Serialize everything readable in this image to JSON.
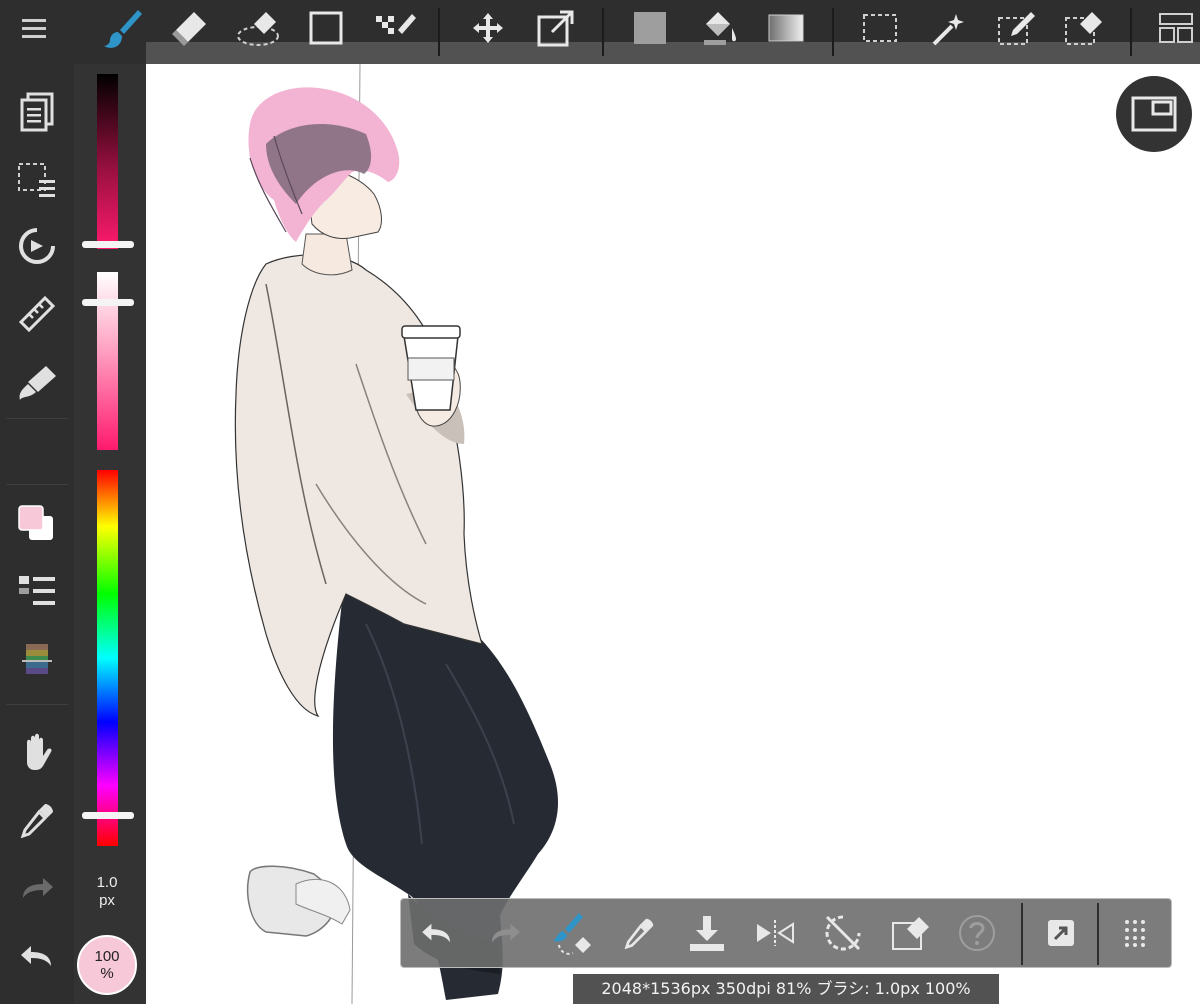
{
  "top_toolbar": {
    "tools": [
      {
        "icon": "brush-icon",
        "active": true
      },
      {
        "icon": "eraser-icon"
      },
      {
        "icon": "blur-eraser-icon"
      },
      {
        "icon": "shape-rectangle-icon"
      },
      {
        "icon": "dot-brush-icon"
      },
      {
        "icon": "move-icon"
      },
      {
        "icon": "transform-icon"
      },
      {
        "icon": "fill-color-icon"
      },
      {
        "icon": "bucket-icon"
      },
      {
        "icon": "gradient-icon"
      },
      {
        "icon": "select-rect-icon"
      },
      {
        "icon": "magic-wand-icon"
      },
      {
        "icon": "select-pen-icon"
      },
      {
        "icon": "select-eraser-icon"
      },
      {
        "icon": "layout-icon"
      }
    ],
    "accent_color": "#2f95c8",
    "fill_color": "#9e9e9e"
  },
  "left_toolbar": {
    "items": [
      "layers-icon",
      "select-menu-icon",
      "rotate-icon",
      "ruler-icon",
      "filter-icon",
      "color-swatch-icon",
      "layer-list-icon",
      "palette-icon",
      "hand-icon",
      "eyedropper-icon",
      "redo-icon",
      "undo-icon"
    ]
  },
  "color_sliders": {
    "primary_color": "#f6c8d8",
    "secondary_color": "#ffffff"
  },
  "brush": {
    "size_value": "1.0",
    "size_unit": "px",
    "opacity_value": "100",
    "opacity_unit": "%"
  },
  "quick_bar": {
    "buttons": [
      "undo-icon",
      "redo-icon",
      "brush-eraser-toggle-icon",
      "eyedropper-icon",
      "save-download-icon",
      "flip-horizontal-icon",
      "rotate-reset-icon",
      "clear-eraser-icon",
      "help-icon",
      "fullscreen-icon",
      "more-grid-icon"
    ]
  },
  "status_bar": {
    "text": "2048*1536px 350dpi 81% ブラシ: 1.0px 100%"
  },
  "navigator_button": {
    "icon": "navigator-icon"
  }
}
